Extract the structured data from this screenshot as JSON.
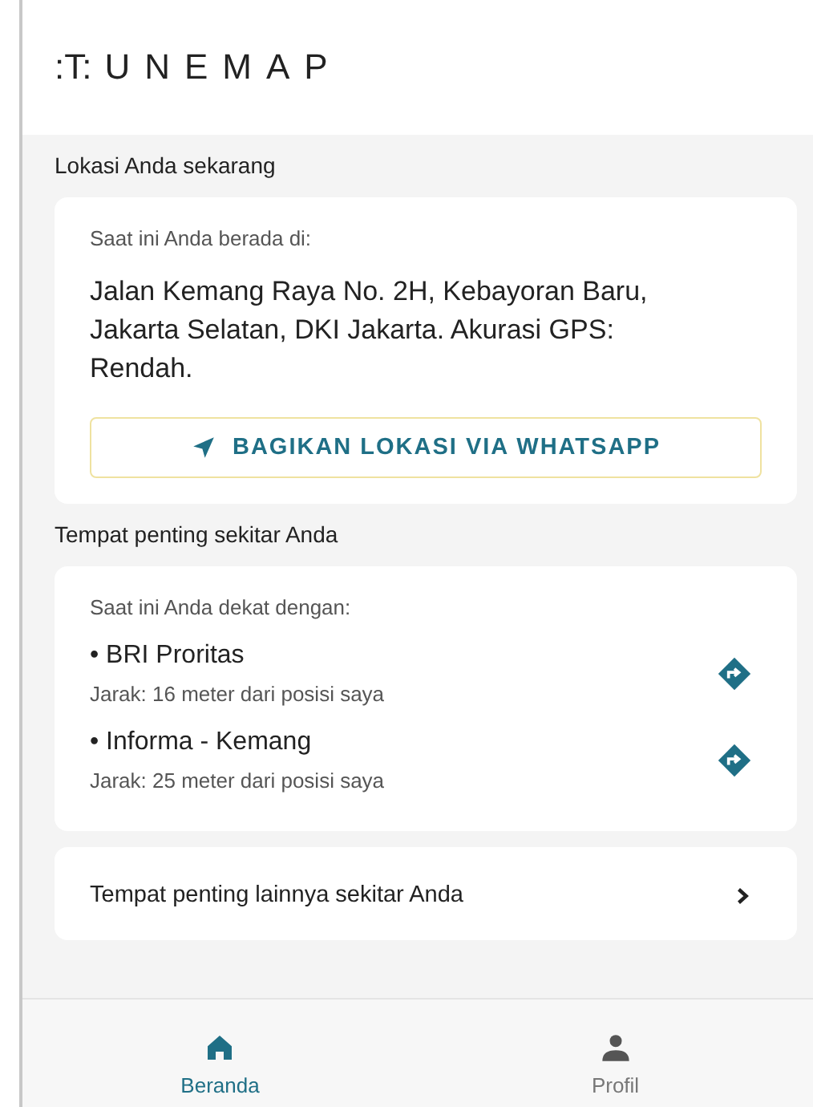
{
  "header": {
    "logo_mark": ":T:",
    "logo_text": "UNEMAP"
  },
  "location_section": {
    "title": "Lokasi Anda sekarang",
    "intro": "Saat ini Anda berada di:",
    "address": "Jalan Kemang Raya No. 2H, Kebayoran Baru, Jakarta Selatan, DKI Jakarta. Akurasi GPS: Rendah.",
    "share_button": "BAGIKAN LOKASI VIA WHATSAPP"
  },
  "places_section": {
    "title": "Tempat penting sekitar Anda",
    "intro": "Saat ini Anda dekat dengan:",
    "places": [
      {
        "name": "• BRI Proritas",
        "distance": "Jarak: 16 meter dari posisi saya"
      },
      {
        "name": "• Informa - Kemang",
        "distance": "Jarak: 25 meter dari posisi saya"
      }
    ]
  },
  "more_link": "Tempat penting lainnya sekitar Anda",
  "bottom_nav": [
    {
      "label": "Beranda",
      "kind": "home",
      "selected": true
    },
    {
      "label": "Profil",
      "kind": "profile",
      "selected": false
    }
  ]
}
